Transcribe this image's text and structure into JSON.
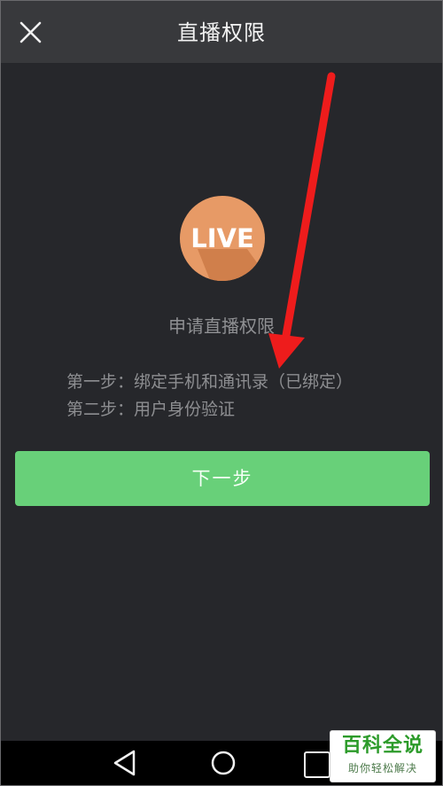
{
  "header": {
    "title": "直播权限",
    "close_icon": "close-icon"
  },
  "logo": {
    "text": "LIVE",
    "circle_color": "#e79a66",
    "shadow_color": "#d07f4b"
  },
  "main": {
    "heading": "申请直播权限",
    "steps": [
      "第一步：绑定手机和通讯录（已绑定）",
      "第二步：用户身份验证"
    ]
  },
  "next_button": {
    "label": "下一步",
    "color": "#68d079"
  },
  "annotation": {
    "arrow_color": "#ee1c1c"
  },
  "nav": {
    "back_icon": "back-triangle-icon",
    "home_icon": "home-circle-icon",
    "recent_icon": "recent-apps-icon"
  },
  "watermark": {
    "main": "百科全说",
    "sub": "助你轻松解决"
  }
}
